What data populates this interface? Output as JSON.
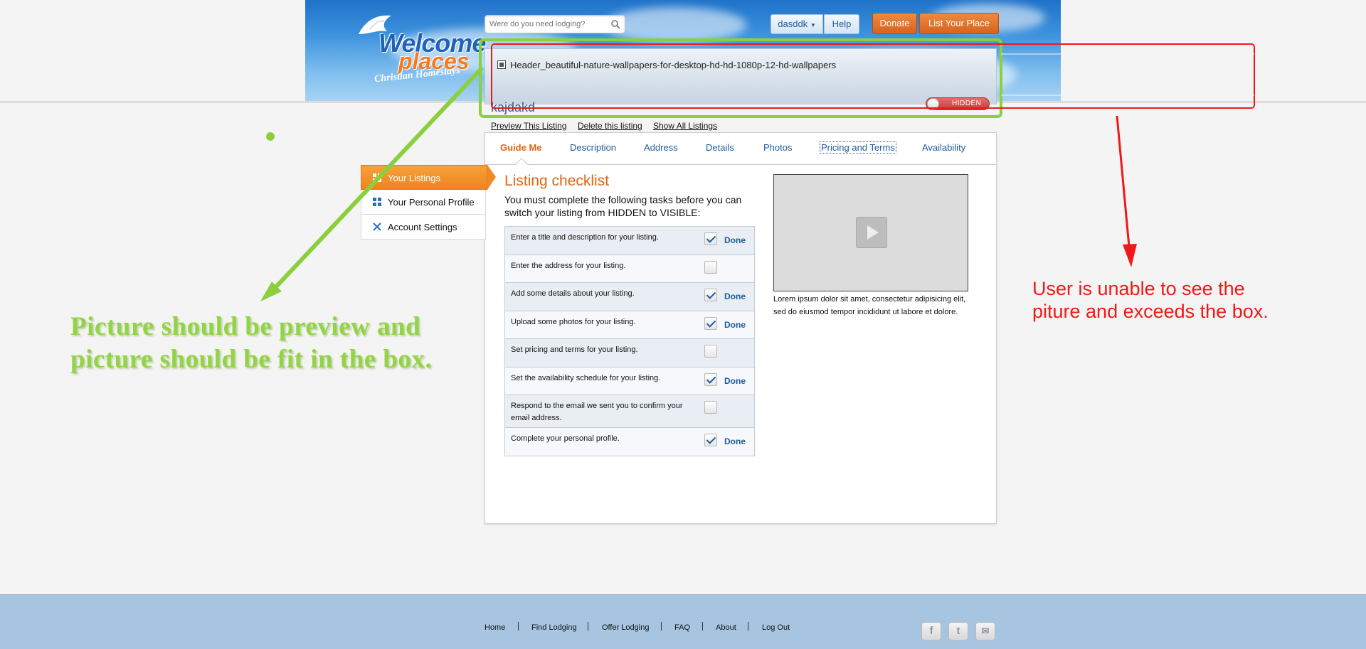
{
  "header": {
    "brand_line1": "Welcome",
    "brand_line2": "places",
    "brand_tagline": "Christian Homestays",
    "search_placeholder": "Were do you need lodging?",
    "user_menu": "dasddk",
    "help_label": "Help",
    "donate_label": "Donate",
    "list_place_label": "List Your Place"
  },
  "listing": {
    "header_image_alt": "Header_beautiful-nature-wallpapers-for-desktop-hd-hd-1080p-12-hd-wallpapers",
    "name": "kajdakd",
    "visibility_status": "HIDDEN",
    "links": [
      "Preview This Listing",
      "Delete this listing",
      "Show All Listings"
    ]
  },
  "tabs": [
    {
      "label": "Guide Me",
      "active": true
    },
    {
      "label": "Description",
      "active": false
    },
    {
      "label": "Address",
      "active": false
    },
    {
      "label": "Details",
      "active": false
    },
    {
      "label": "Photos",
      "active": false
    },
    {
      "label": "Pricing and Terms",
      "active": false
    },
    {
      "label": "Availability",
      "active": false
    }
  ],
  "checklist": {
    "title": "Listing checklist",
    "intro": "You must complete the following tasks before you can switch your listing from HIDDEN to VISIBLE:",
    "done_label": "Done",
    "tasks": [
      {
        "text": "Enter a title and description for your listing.",
        "done": true
      },
      {
        "text": "Enter the address for your listing.",
        "done": false
      },
      {
        "text": "Add some details about your listing.",
        "done": true
      },
      {
        "text": "Upload some photos for your listing.",
        "done": true
      },
      {
        "text": "Set pricing and terms for your listing.",
        "done": false
      },
      {
        "text": "Set the availability schedule for your listing.",
        "done": true
      },
      {
        "text": "Respond to the email we sent you to confirm your email address.",
        "done": false
      },
      {
        "text": "Complete your personal profile.",
        "done": true
      }
    ]
  },
  "video": {
    "caption": "Lorem ipsum dolor sit amet, consectetur adipisicing elit, sed do eiusmod tempor incididunt ut labore et dolore."
  },
  "sidebar": {
    "items": [
      {
        "label": "Your Listings",
        "icon": "grid-icon",
        "active": true
      },
      {
        "label": "Your Personal Profile",
        "icon": "grid-icon",
        "active": false
      },
      {
        "label": "Account Settings",
        "icon": "tools-icon",
        "active": false
      }
    ]
  },
  "footer": {
    "links": [
      "Home",
      "Find Lodging",
      "Offer Lodging",
      "FAQ",
      "About",
      "Log Out"
    ],
    "social": [
      "facebook-icon",
      "twitter-icon",
      "mail-icon"
    ]
  },
  "annotations": {
    "green_note_line1": "Picture should be preview and",
    "green_note_line2": "picture should be fit in the box.",
    "red_note_line1": "User is unable to see the",
    "red_note_line2": "piture and exceeds the box.",
    "green_color": "#8ccf3c",
    "red_color": "#f01818"
  }
}
